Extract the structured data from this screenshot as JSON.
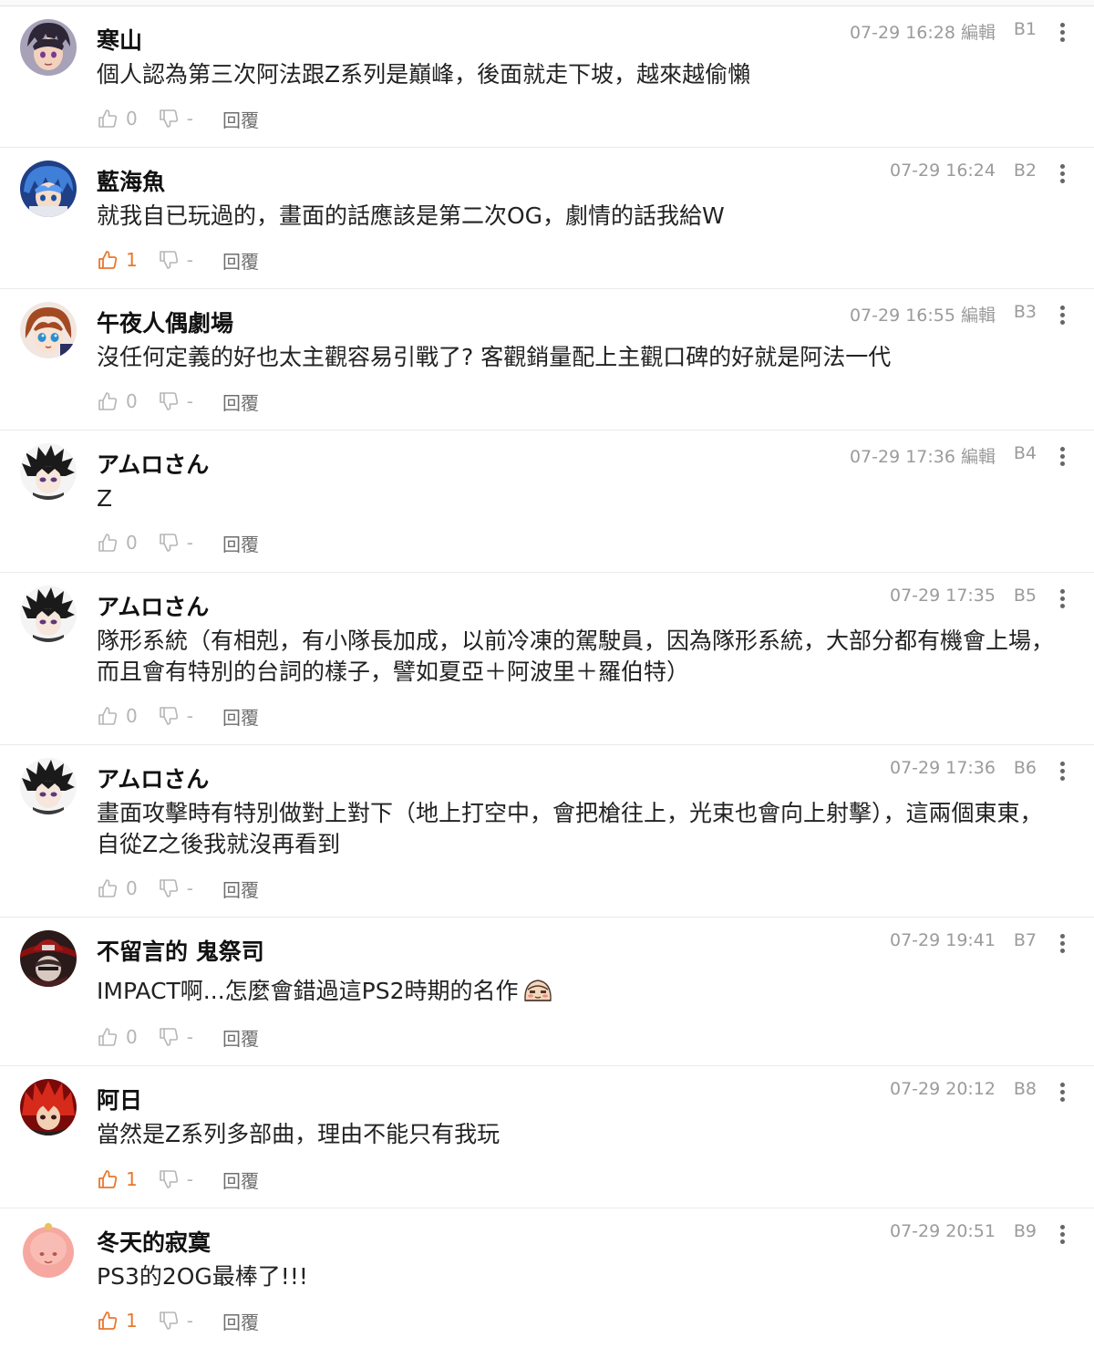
{
  "colors": {
    "accent_like": "#e8772e",
    "muted": "#9b9b9b",
    "divider": "#ebebeb"
  },
  "comments": [
    {
      "user": "寒山",
      "time": "07-29 16:28 編輯",
      "floor": "B1",
      "text": "個人認為第三次阿法跟Z系列是巔峰，後面就走下坡，越來越偷懶",
      "likes": "0",
      "liked": false,
      "dislikes": "-",
      "reply": "回覆"
    },
    {
      "user": "藍海魚",
      "time": "07-29 16:24",
      "floor": "B2",
      "text": "就我自已玩過的，畫面的話應該是第二次OG，劇情的話我給W",
      "likes": "1",
      "liked": true,
      "dislikes": "-",
      "reply": "回覆"
    },
    {
      "user": "午夜人偶劇場",
      "time": "07-29 16:55 編輯",
      "floor": "B3",
      "text": "沒任何定義的好也太主觀容易引戰了? 客觀銷量配上主觀口碑的好就是阿法一代",
      "likes": "0",
      "liked": false,
      "dislikes": "-",
      "reply": "回覆"
    },
    {
      "user": "アムロさん",
      "time": "07-29 17:36 編輯",
      "floor": "B4",
      "text": "Z",
      "likes": "0",
      "liked": false,
      "dislikes": "-",
      "reply": "回覆"
    },
    {
      "user": "アムロさん",
      "time": "07-29 17:35",
      "floor": "B5",
      "text": "隊形系統（有相剋，有小隊長加成，以前冷凍的駕駛員，因為隊形系統，大部分都有機會上場，而且會有特別的台詞的樣子，譬如夏亞＋阿波里＋羅伯特）",
      "likes": "0",
      "liked": false,
      "dislikes": "-",
      "reply": "回覆"
    },
    {
      "user": "アムロさん",
      "time": "07-29 17:36",
      "floor": "B6",
      "text": "畫面攻擊時有特別做對上對下（地上打空中，會把槍往上，光束也會向上射擊），這兩個東東，自從Z之後我就沒再看到",
      "likes": "0",
      "liked": false,
      "dislikes": "-",
      "reply": "回覆"
    },
    {
      "user": "不留言的 鬼祭司",
      "time": "07-29 19:41",
      "floor": "B7",
      "text": "IMPACT啊...怎麼會錯過這PS2時期的名作",
      "likes": "0",
      "liked": false,
      "dislikes": "-",
      "reply": "回覆",
      "emoji": "shy-face-emoji"
    },
    {
      "user": "阿日",
      "time": "07-29 20:12",
      "floor": "B8",
      "text": "當然是Z系列多部曲，理由不能只有我玩",
      "likes": "1",
      "liked": true,
      "dislikes": "-",
      "reply": "回覆"
    },
    {
      "user": "冬天的寂寞",
      "time": "07-29 20:51",
      "floor": "B9",
      "text": "PS3的2OG最棒了!!!",
      "likes": "1",
      "liked": true,
      "dislikes": "-",
      "reply": "回覆"
    }
  ]
}
